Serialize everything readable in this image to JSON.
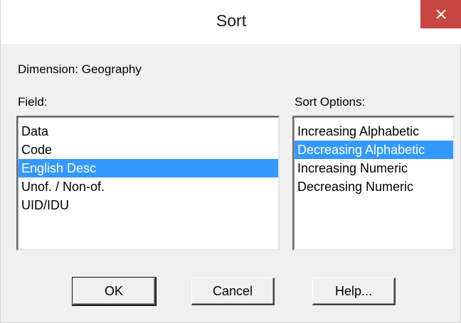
{
  "window": {
    "title": "Sort",
    "close_icon": "close-x-icon"
  },
  "dimension_label": "Dimension: Geography",
  "field": {
    "label": "Field:",
    "items": [
      "Data",
      "Code",
      "English Desc",
      "Unof. / Non-of.",
      "UID/IDU"
    ],
    "selected": "English Desc"
  },
  "sort_options": {
    "label": "Sort Options:",
    "items": [
      "Increasing Alphabetic",
      "Decreasing Alphabetic",
      "Increasing Numeric",
      "Decreasing Numeric"
    ],
    "selected": "Decreasing Alphabetic"
  },
  "buttons": {
    "ok": "OK",
    "cancel": "Cancel",
    "help": "Help..."
  },
  "colors": {
    "selection": "#3399ff",
    "close_button": "#c7463f"
  }
}
